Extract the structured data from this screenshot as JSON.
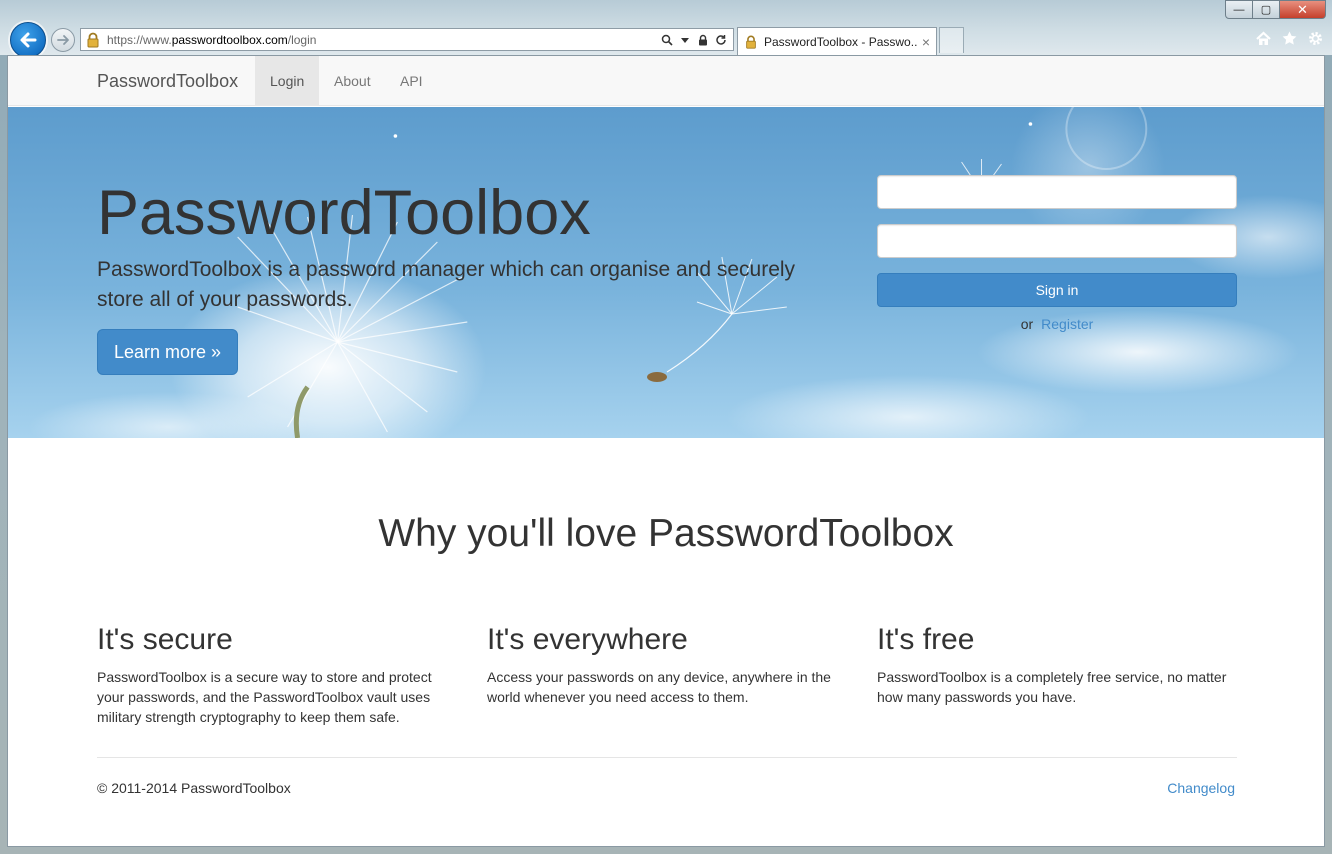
{
  "browser": {
    "url_prefix": "https://www.",
    "url_host": "passwordtoolbox.com",
    "url_path": "/login",
    "tab_title": "PasswordToolbox - Passwo...",
    "tab_close": "×",
    "window_min": "—",
    "window_max": "▢",
    "window_close": "✕"
  },
  "navbar": {
    "brand": "PasswordToolbox",
    "links": [
      {
        "label": "Login",
        "active": true
      },
      {
        "label": "About"
      },
      {
        "label": "API"
      }
    ]
  },
  "hero": {
    "title": "PasswordToolbox",
    "text": "PasswordToolbox is a password manager which can organise and securely store all of your passwords.",
    "learn_more": "Learn more »"
  },
  "login": {
    "username_value": "",
    "password_value": "",
    "sign_in": "Sign in",
    "or": "or",
    "register": "Register"
  },
  "features": {
    "heading": "Why you'll love PasswordToolbox",
    "items": [
      {
        "title": "It's secure",
        "text": "PasswordToolbox is a secure way to store and protect your passwords, and the PasswordToolbox vault uses military strength cryptography to keep them safe."
      },
      {
        "title": "It's everywhere",
        "text": "Access your passwords on any device, anywhere in the world whenever you need access to them."
      },
      {
        "title": "It's free",
        "text": "PasswordToolbox is a completely free service, no matter how many passwords you have."
      }
    ]
  },
  "footer": {
    "copyright": "© 2011-2014 PasswordToolbox",
    "changelog": "Changelog"
  },
  "colors": {
    "primary": "#428bca",
    "navbar_bg": "#f8f8f8",
    "text": "#333333"
  }
}
